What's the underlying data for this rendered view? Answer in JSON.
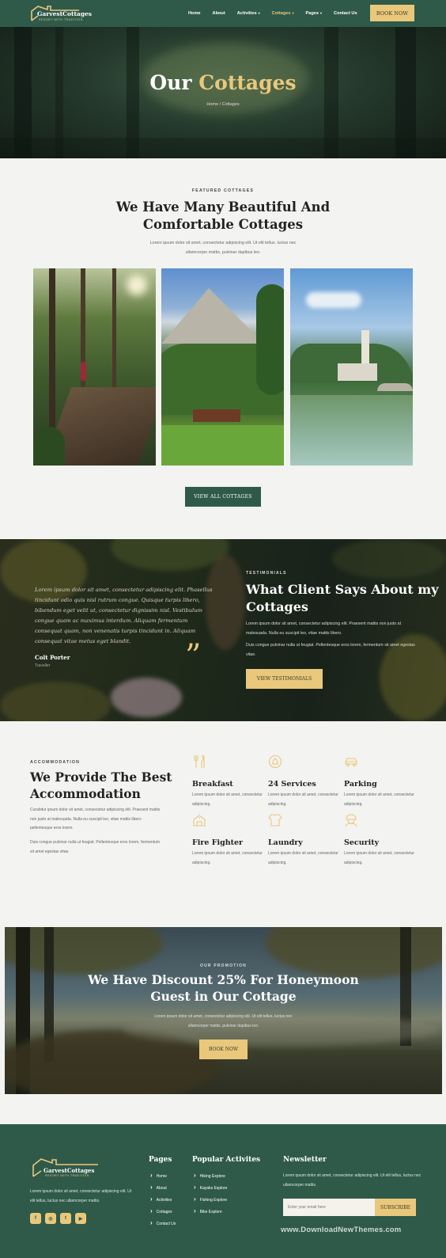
{
  "header": {
    "logo_text": "GarvestCottages",
    "logo_sub": "RESORT WITH TRADITION",
    "nav": [
      {
        "label": "Home",
        "dropdown": false
      },
      {
        "label": "About",
        "dropdown": false
      },
      {
        "label": "Activities",
        "dropdown": true
      },
      {
        "label": "Cottages",
        "dropdown": true,
        "active": true
      },
      {
        "label": "Pages",
        "dropdown": true
      },
      {
        "label": "Contact Us",
        "dropdown": false
      }
    ],
    "book_label": "BOOK NOW"
  },
  "hero": {
    "title_white": "Our",
    "title_gold": "Cottages",
    "breadcrumb": "Home / Cottages"
  },
  "featured": {
    "eyebrow": "FEATURED COTTAGES",
    "title_line1": "We Have Many Beautiful And",
    "title_line2": "Comfortable Cottages",
    "text_line1": "Lorem ipsum dolor sit amet, consectetur adipiscing elit. Ut elit tellus, luctus nec",
    "text_line2": "ullamcorper mattis, pulvinar dapibus leo.",
    "view_all_label": "VIEW ALL COTTAGES"
  },
  "testimonial": {
    "quote": "Lorem ipsum dolor sit amet, consectetur adipiscing elit. Phasellus tincidunt odio quis nisl rutrum congue. Quisque turpis libero, bibendum eget velit ut, consectetur dignissim nisl. Vestibulum congue quam ac maximus interdum. Aliquam fermentum consequat quam, non venenatis turpis tincidunt in. Aliquam consequat vitae metus eget blandit.",
    "name": "Colt Porter",
    "role": "Traveller",
    "eyebrow": "TESTIMONIALS",
    "title_line1": "What Client Says About my",
    "title_line2": "Cottages",
    "p1": "Lorem ipsum dolor sit amet, consectetur adipiscing elit. Praesent mattis non justo at malesuada. Nulla eu suscipit leo, vitae mattis libero.",
    "p2": "Duis congue pulvinar nulla ut feugiat. Pellentesque eros lorem, fermentum sit amet egestas vitae.",
    "button_label": "VIEW TESTIMONIALS"
  },
  "accommodation": {
    "eyebrow": "ACCOMMODATION",
    "title_line1": "We Provide The Best",
    "title_line2": "Accommodation",
    "p1": "Curabitur ipsum dolor sit amet, consectetur adipiscing elit. Praesent mattis non justo at malesuada. Nulla eu suscipit leo, vitae mattis libero pellentesque eros lorem.",
    "p2": "Duis congue pulvinar nulla ut feugiat. Pellentesque eros lorem, fermentum sit amet egestas vitae.",
    "services": [
      {
        "name": "Breakfast",
        "icon": "utensils-icon",
        "desc": "Lorem ipsum dolor sit amet, consectetur adipiscing."
      },
      {
        "name": "24 Services",
        "icon": "service-bell-icon",
        "desc": "Lorem ipsum dolor sit amet, consectetur adipiscing."
      },
      {
        "name": "Parking",
        "icon": "car-icon",
        "desc": "Lorem ipsum dolor sit amet, consectetur adipiscing."
      },
      {
        "name": "Fire Fighter",
        "icon": "fire-station-icon",
        "desc": "Lorem ipsum dolor sit amet, consectetur adipiscing."
      },
      {
        "name": "Laundry",
        "icon": "laundry-icon",
        "desc": "Lorem ipsum dolor sit amet, consectetur adipiscing."
      },
      {
        "name": "Security",
        "icon": "security-guard-icon",
        "desc": "Lorem ipsum dolor sit amet, consectetur adipiscing."
      }
    ]
  },
  "promotion": {
    "eyebrow": "OUR PROMOTION",
    "title_line1": "We Have Discount 25% For Honeymoon",
    "title_line2": "Guest in Our Cottage",
    "text_line1": "Lorem ipsum dolor sit amet, consectetur adipiscing elit. Ut elit tellus, luctus nec",
    "text_line2": "ullamcorper mattis, pulvinar dapibus leo.",
    "button_label": "BOOK NOW"
  },
  "footer": {
    "logo_text": "GarvestCottages",
    "logo_sub": "RESORT WITH TRADITION",
    "about": "Lorem ipsum dolor sit amet, consectetur adipiscing elit. Ut elit tellus, luctus nec ullamcorper mattis.",
    "socials": [
      "facebook-icon",
      "instagram-icon",
      "twitter-icon",
      "youtube-icon"
    ],
    "pages_heading": "Pages",
    "pages": [
      "Home",
      "About",
      "Activities",
      "Cottages",
      "Contact Us"
    ],
    "activities_heading": "Popular Activites",
    "activities": [
      "Hiking Explore",
      "Kayaks Explore",
      "Fishing Explore",
      "Bike Explore"
    ],
    "newsletter_heading": "Newsletter",
    "newsletter_text": "Lorem ipsum dolor sit amet, consectetur adipiscing elit. Ut elit tellus, luctus nec ullamcorper mattis.",
    "email_placeholder": "Enter your email here",
    "subscribe_label": "SUBSCRIBE",
    "watermark": "www.DownloadNewThemes.com"
  },
  "colors": {
    "primary_green": "#2f5a4a",
    "accent_gold": "#e9c87c",
    "background": "#f3f3f1"
  }
}
